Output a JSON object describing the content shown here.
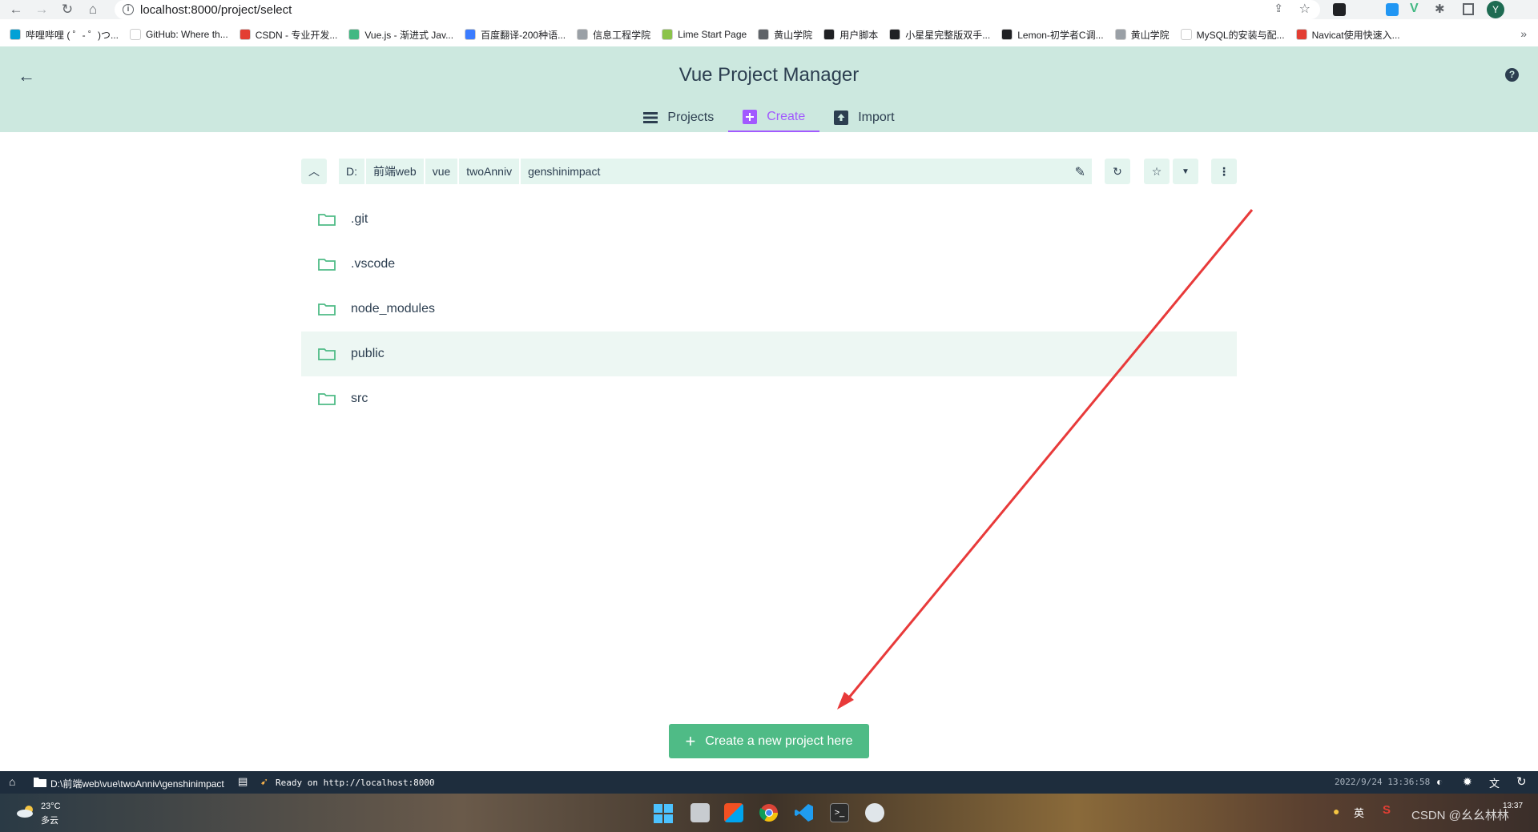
{
  "browser": {
    "url": "localhost:8000/project/select",
    "bookmarks": [
      {
        "label": "哔哩哔哩 ( ゜- ゜)つ...",
        "color": "#00a1d6"
      },
      {
        "label": "GitHub: Where th...",
        "color": "#ffffff"
      },
      {
        "label": "CSDN - 专业开发...",
        "color": "#e33e33"
      },
      {
        "label": "Vue.js - 渐进式 Jav...",
        "color": "#42b883"
      },
      {
        "label": "百度翻译-200种语...",
        "color": "#3b7cff"
      },
      {
        "label": "信息工程学院",
        "color": "#9aa0a6"
      },
      {
        "label": "Lime Start Page",
        "color": "#8bc34a"
      },
      {
        "label": "黄山学院",
        "color": "#5f6368"
      },
      {
        "label": "用户脚本",
        "color": "#202124"
      },
      {
        "label": "小星星完整版双手...",
        "color": "#202124"
      },
      {
        "label": "Lemon-初学者C调...",
        "color": "#202124"
      },
      {
        "label": "黄山学院",
        "color": "#9aa0a6"
      },
      {
        "label": "MySQL的安装与配...",
        "color": "#ffffff"
      },
      {
        "label": "Navicat使用快速入...",
        "color": "#e33e33"
      }
    ],
    "profile_initial": "Y"
  },
  "header": {
    "title": "Vue Project Manager",
    "tabs": [
      {
        "label": "Projects",
        "active": false
      },
      {
        "label": "Create",
        "active": true
      },
      {
        "label": "Import",
        "active": false
      }
    ],
    "accent": "#a259ff",
    "background": "#cce8df"
  },
  "path": {
    "crumbs": [
      "D:",
      "前端web",
      "vue",
      "twoAnniv",
      "genshinimpact"
    ]
  },
  "folders": [
    {
      "name": ".git"
    },
    {
      "name": ".vscode"
    },
    {
      "name": "node_modules"
    },
    {
      "name": "public"
    },
    {
      "name": "src"
    }
  ],
  "create_button": {
    "label": "Create a new project here",
    "color": "#4fbb86"
  },
  "status_bar": {
    "cwd": "D:\\前端web\\vue\\twoAnniv\\genshinimpact",
    "log": "Ready on http://localhost:8000",
    "datetime": "2022/9/24  13:36:58"
  },
  "taskbar": {
    "weather_temp": "23°C",
    "weather_desc": "多云",
    "clock": "13:37",
    "watermark": "CSDN @幺幺林林"
  }
}
